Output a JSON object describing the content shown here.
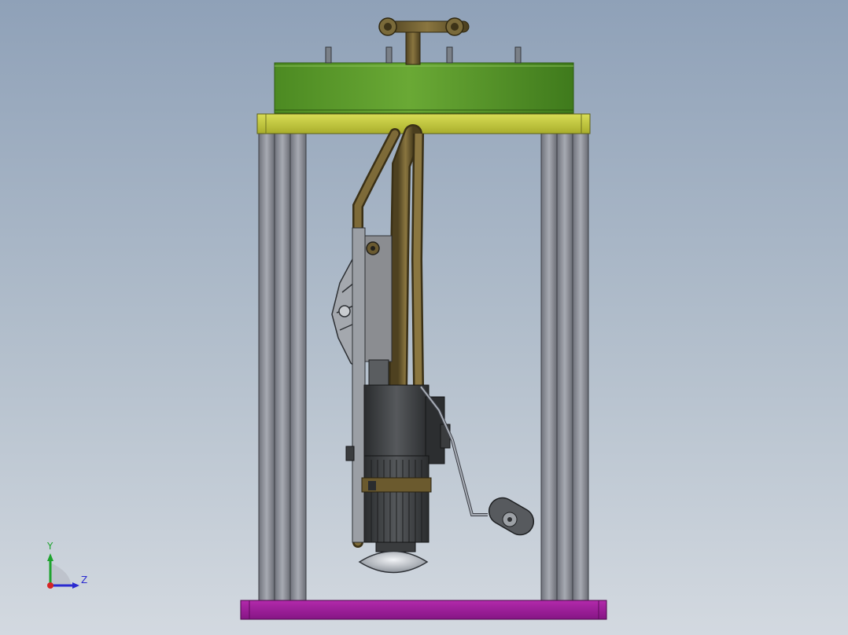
{
  "triad": {
    "y_label": "Y",
    "z_label": "Z"
  },
  "colors": {
    "background_top": "#8fa1b8",
    "background_bottom": "#d3d9e0",
    "tank": "#5a9a2a",
    "top_plate": "#c9cf3f",
    "base_plate": "#a01a9a",
    "frame": "#8c8f99",
    "pipe": "#6b5a2e",
    "pump_body": "#3a3c3e",
    "float": "#5a5a5a"
  },
  "icons": {
    "coordinate_triad": "xyz-axis-triad-icon"
  }
}
